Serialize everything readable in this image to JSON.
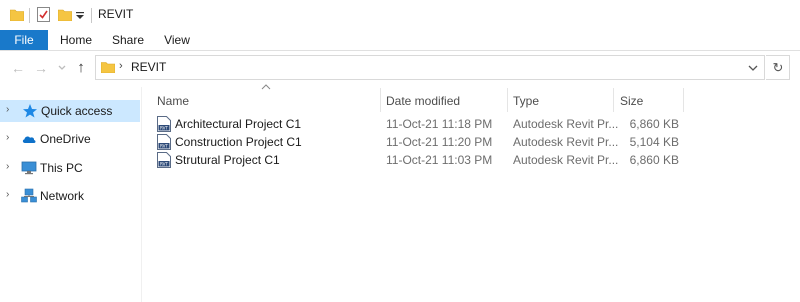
{
  "window": {
    "title": "REVIT"
  },
  "ribbon": {
    "tabs": [
      {
        "label": "File"
      },
      {
        "label": "Home"
      },
      {
        "label": "Share"
      },
      {
        "label": "View"
      }
    ]
  },
  "address": {
    "path": "REVIT"
  },
  "nav_pane": {
    "items": [
      {
        "label": "Quick access",
        "icon": "star-icon",
        "selected": true
      },
      {
        "label": "OneDrive",
        "icon": "cloud-icon"
      },
      {
        "label": "This PC",
        "icon": "computer-icon"
      },
      {
        "label": "Network",
        "icon": "network-icon"
      }
    ]
  },
  "file_list": {
    "columns": [
      "Name",
      "Date modified",
      "Type",
      "Size"
    ],
    "rows": [
      {
        "name": "Architectural Project C1",
        "date": "11-Oct-21 11:18 PM",
        "type": "Autodesk Revit Pr...",
        "size": "6,860 KB"
      },
      {
        "name": "Construction Project C1",
        "date": "11-Oct-21 11:20 PM",
        "type": "Autodesk Revit Pr...",
        "size": "5,104 KB"
      },
      {
        "name": "Strutural Project C1",
        "date": "11-Oct-21 11:03 PM",
        "type": "Autodesk Revit Pr...",
        "size": "6,860 KB"
      }
    ]
  },
  "colors": {
    "accent": "#1979ca",
    "selection": "#cce8ff",
    "folder": "#f5c542"
  }
}
